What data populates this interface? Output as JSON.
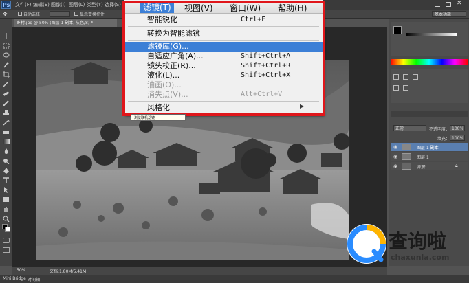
{
  "app": {
    "logo": "Ps",
    "menus": [
      "文件(F)",
      "编辑(E)",
      "图像(I)",
      "图层(L)",
      "类型(Y)",
      "选择(S)"
    ]
  },
  "options_bar": {
    "auto_select": "自动选择：",
    "show_transform": "显示变换控件"
  },
  "document": {
    "tab": "乡村.jpg @ 50% (图层 1 副本, 灰色/8) *"
  },
  "menubar": {
    "items": [
      "滤镜(T)",
      "视图(V)",
      "窗口(W)",
      "帮助(H)"
    ]
  },
  "filter_menu": {
    "last_filter": {
      "label": "智能锐化",
      "shortcut": "Ctrl+F"
    },
    "convert_smart": "转换为智能滤镜",
    "gallery": "滤镜库(G)...",
    "adaptive": {
      "label": "自适应广角(A)...",
      "shortcut": "Shift+Ctrl+A"
    },
    "lens": {
      "label": "镜头校正(R)...",
      "shortcut": "Shift+Ctrl+R"
    },
    "liquify": {
      "label": "液化(L)...",
      "shortcut": "Shift+Ctrl+X"
    },
    "oil": "油画(O)...",
    "vanishing": {
      "label": "消失点(V)...",
      "shortcut": "Alt+Ctrl+V"
    },
    "stylize": "风格化"
  },
  "tooltip": "浏览联机滤镜",
  "right_panel": {
    "workspace": "基本功能",
    "blend_mode": "正常",
    "opacity_label": "不透明度：",
    "opacity": "100%",
    "fill_label": "填充：",
    "fill": "100%",
    "layers": [
      "图层 1 副本",
      "图层 1",
      "背景"
    ]
  },
  "status": {
    "zoom": "50%",
    "doc": "文档:1.80M/5.41M"
  },
  "bottom": {
    "mini_bridge": "Mini Bridge",
    "timeline": "时间轴"
  },
  "watermark": {
    "text": "查询啦",
    "url": "chaxunla.com"
  }
}
